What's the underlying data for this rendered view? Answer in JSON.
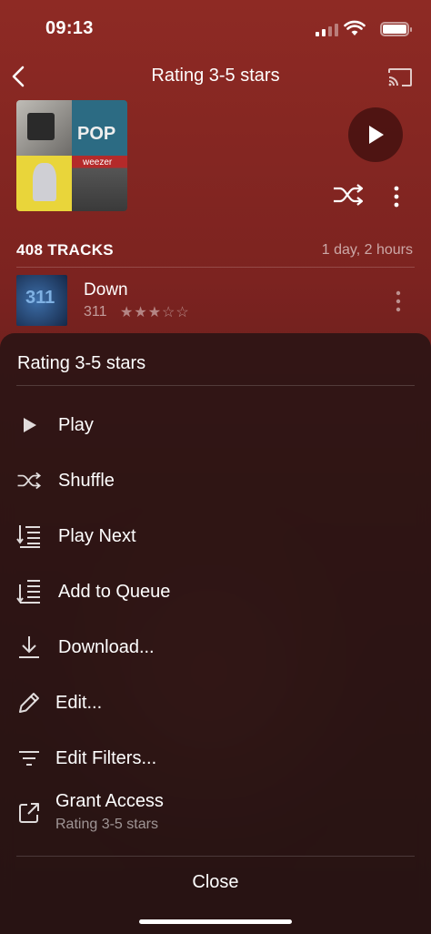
{
  "status_bar": {
    "time": "09:13"
  },
  "nav": {
    "title": "Rating 3-5 stars"
  },
  "playlist": {
    "track_count_label": "408 TRACKS",
    "duration": "1 day, 2 hours"
  },
  "track": {
    "title": "Down",
    "artist": "311",
    "rating_stars": "★★★☆☆",
    "rating": 3
  },
  "sheet": {
    "title": "Rating 3-5 stars",
    "items": [
      {
        "label": "Play",
        "icon": "play-icon"
      },
      {
        "label": "Shuffle",
        "icon": "shuffle-icon"
      },
      {
        "label": "Play Next",
        "icon": "play-next-icon"
      },
      {
        "label": "Add to Queue",
        "icon": "add-to-queue-icon"
      },
      {
        "label": "Download...",
        "icon": "download-icon"
      },
      {
        "label": "Edit...",
        "icon": "pencil-icon"
      },
      {
        "label": "Edit Filters...",
        "icon": "filter-icon"
      },
      {
        "label": "Grant Access",
        "icon": "share-icon",
        "sublabel": "Rating 3-5 stars"
      }
    ],
    "close_label": "Close"
  },
  "colors": {
    "background": "#7c2320",
    "sheet": "#281414"
  }
}
